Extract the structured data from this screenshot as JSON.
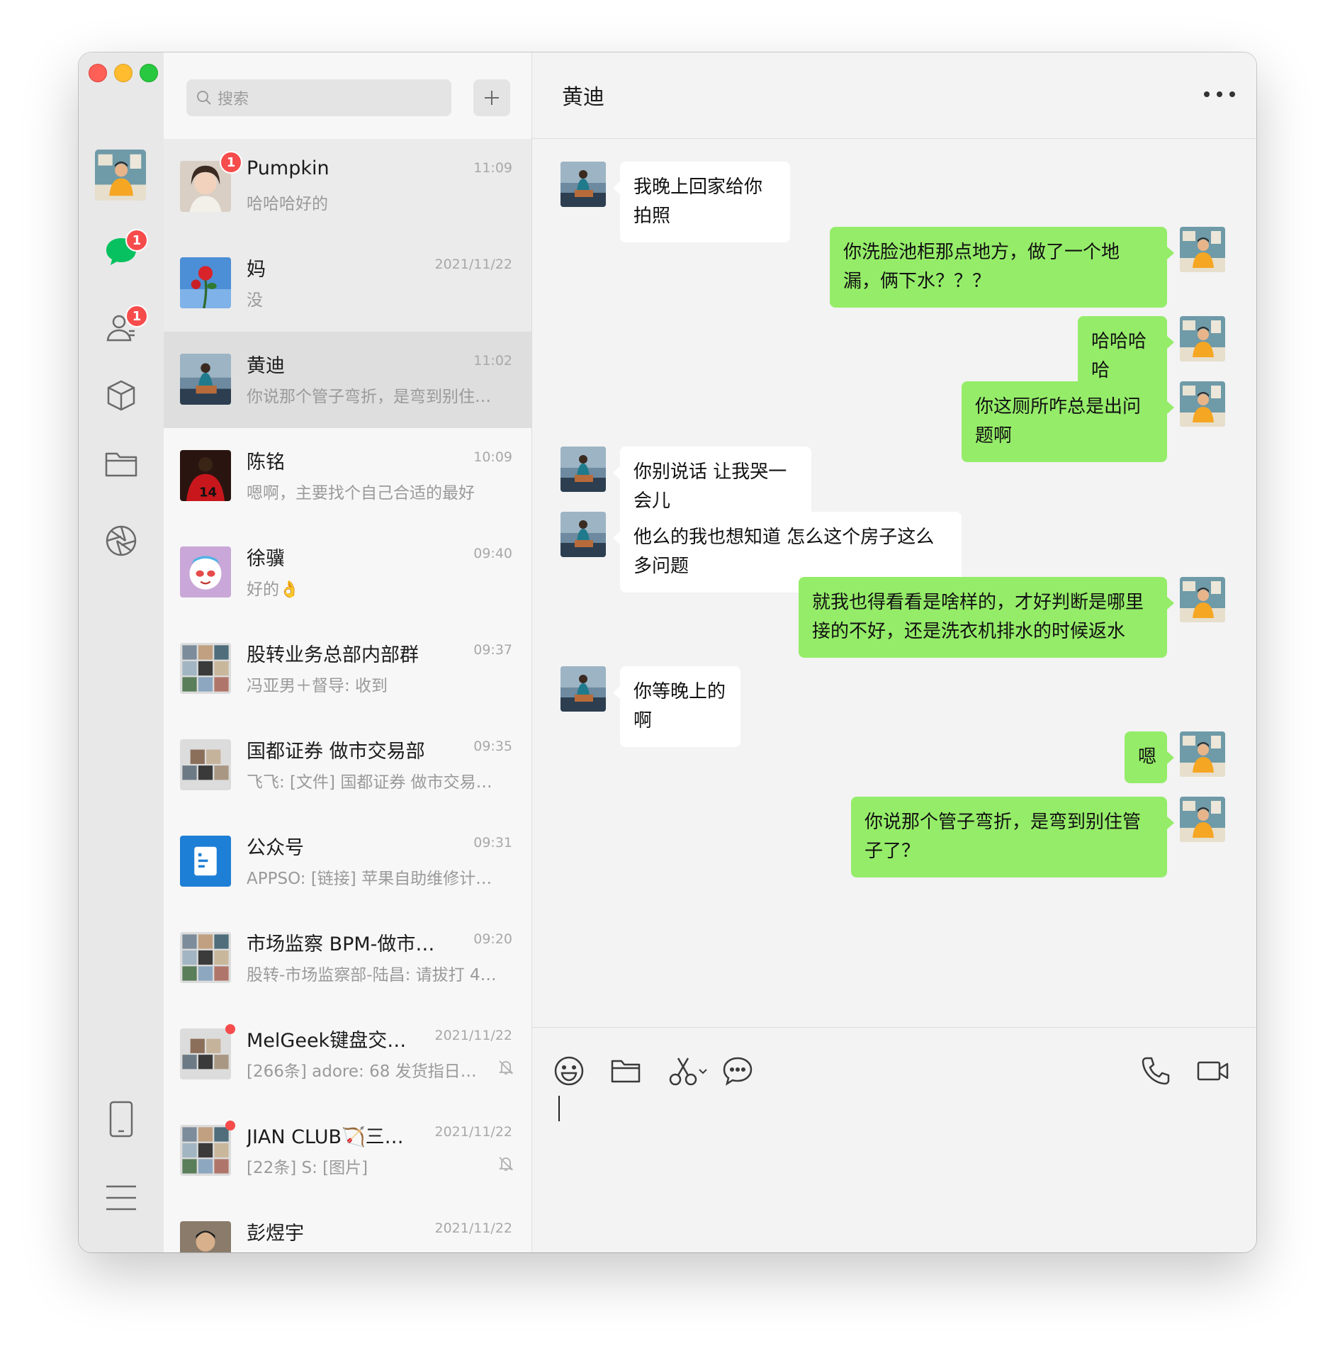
{
  "search": {
    "placeholder": "搜索"
  },
  "rail": {
    "chat_badge": "1",
    "contacts_badge": "1"
  },
  "chats": [
    {
      "name": "Pumpkin",
      "time": "11:09",
      "preview": "哈哈哈好的",
      "badge": "1",
      "state": "pinned",
      "avatar": "pumpkin"
    },
    {
      "name": "妈",
      "time": "2021/11/22",
      "preview": "没",
      "state": "pinned",
      "avatar": "rose"
    },
    {
      "name": "黄迪",
      "time": "11:02",
      "preview": "你说那个管子弯折，是弯到别住…",
      "state": "active",
      "avatar": "huangdi"
    },
    {
      "name": "陈铭",
      "time": "10:09",
      "preview": "嗯啊，主要找个自己合适的最好",
      "state": "normal",
      "avatar": "jersey"
    },
    {
      "name": "徐骥",
      "time": "09:40",
      "preview": "好的👌",
      "state": "normal",
      "avatar": "cartoon"
    },
    {
      "name": "股转业务总部内部群",
      "time": "09:37",
      "preview": "冯亚男＋督导: 收到",
      "state": "normal",
      "avatar": "group"
    },
    {
      "name": "国都证券 做市交易部",
      "time": "09:35",
      "preview": "飞飞: [文件] 国都证券 做市交易…",
      "state": "normal",
      "avatar": "group2"
    },
    {
      "name": "公众号",
      "time": "09:31",
      "preview": "APPSO: [链接] 苹果自助维修计…",
      "state": "normal",
      "avatar": "official"
    },
    {
      "name": "市场监察 BPM-做市…",
      "time": "09:20",
      "preview": "股转-市场监察部-陆昌: 请拔打 4…",
      "state": "normal",
      "avatar": "group3"
    },
    {
      "name": "MelGeek键盘交…",
      "time": "2021/11/22",
      "preview": "[266条] adore: 68 发货指日…",
      "state": "normal",
      "avatar": "group4",
      "dot": true,
      "muted": true
    },
    {
      "name": "JIAN CLUB🏹三…",
      "time": "2021/11/22",
      "preview": "[22条] S: [图片]",
      "state": "normal",
      "avatar": "group5",
      "dot": true,
      "muted": true
    },
    {
      "name": "彭煜宇",
      "time": "2021/11/22",
      "preview": "",
      "state": "normal",
      "avatar": "person"
    }
  ],
  "conversation": {
    "title": "黄迪",
    "messages": [
      {
        "dir": "in",
        "text": "我晚上回家给你拍照"
      },
      {
        "dir": "out",
        "text": "你洗脸池柜那点地方，做了一个地漏，俩下水？？？"
      },
      {
        "dir": "out",
        "text": "哈哈哈哈"
      },
      {
        "dir": "out",
        "text": "你这厕所咋总是出问题啊"
      },
      {
        "dir": "in",
        "text": "你别说话 让我哭一会儿"
      },
      {
        "dir": "in",
        "text": "他么的我也想知道 怎么这个房子这么多问题"
      },
      {
        "dir": "out",
        "text": "就我也得看看是啥样的，才好判断是哪里接的不好，还是洗衣机排水的时候返水"
      },
      {
        "dir": "in",
        "text": "你等晚上的啊"
      },
      {
        "dir": "out",
        "text": "嗯"
      },
      {
        "dir": "out",
        "text": "你说那个管子弯折，是弯到别住管子了？"
      }
    ]
  },
  "colors": {
    "outgoing_bubble": "#95ec69",
    "incoming_bubble": "#ffffff",
    "badge": "#f74c4c",
    "accent_green": "#07c160"
  }
}
